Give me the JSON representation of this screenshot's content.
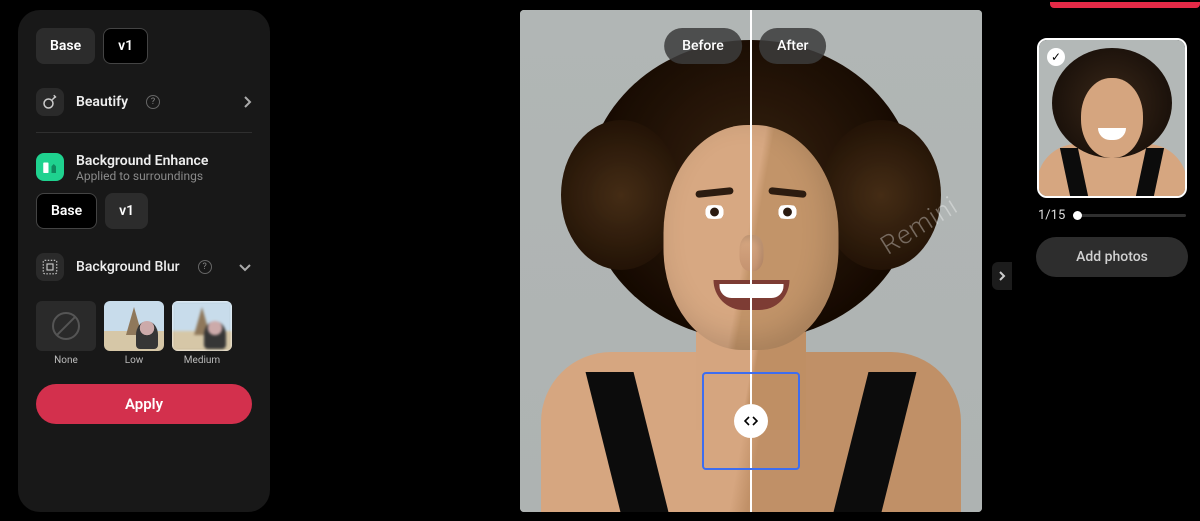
{
  "watermark": "Remini",
  "panel": {
    "version_options": {
      "base": "Base",
      "v1": "v1"
    },
    "beautify": {
      "label": "Beautify"
    },
    "bg_enhance": {
      "title": "Background Enhance",
      "subtitle": "Applied to surroundings",
      "options": {
        "base": "Base",
        "v1": "v1"
      }
    },
    "bg_blur": {
      "label": "Background Blur",
      "options": {
        "none": "None",
        "low": "Low",
        "medium": "Medium"
      },
      "selected": "medium"
    },
    "apply": "Apply"
  },
  "compare": {
    "before": "Before",
    "after": "After"
  },
  "rail": {
    "counter": "1/15",
    "add": "Add photos"
  }
}
